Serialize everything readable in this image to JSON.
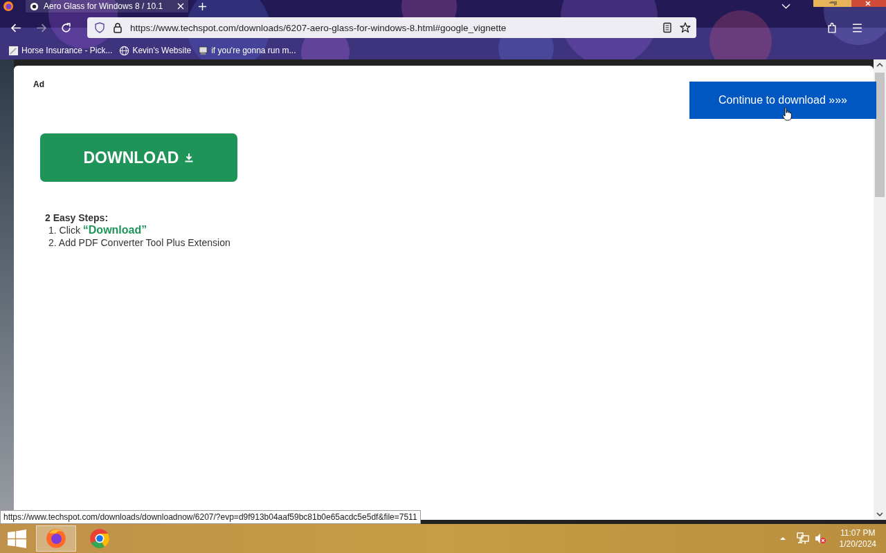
{
  "browser": {
    "tabs": [
      {
        "title": "Aero Glass for Windows 8 / 10.1",
        "selected": true
      }
    ],
    "address": {
      "url": "https://www.techspot.com/downloads/6207-aero-glass-for-windows-8.html#google_vignette"
    },
    "bookmarks": [
      {
        "label": "Horse Insurance - Pick..."
      },
      {
        "label": "Kevin's Website"
      },
      {
        "label": "if you're gonna run m..."
      }
    ]
  },
  "ad": {
    "label": "Ad",
    "continue_button": "Continue to download »»»",
    "download_button": "DOWNLOAD",
    "steps_title": "2 Easy Steps:",
    "steps": [
      {
        "text": "1. Click",
        "highlight": "“Download”"
      },
      {
        "text": "2. Add PDF Converter Tool Plus Extension"
      }
    ]
  },
  "status_link": "https://www.techspot.com/downloads/downloadnow/6207/?evp=d9f913b04aaf59bc81b0e65acdc5e5df&file=7511",
  "taskbar": {
    "apps": [
      {
        "kind": "firefox",
        "selected": true
      },
      {
        "kind": "chrome",
        "selected": false
      }
    ],
    "time": "11:07 PM",
    "date": "1/20/2024"
  }
}
